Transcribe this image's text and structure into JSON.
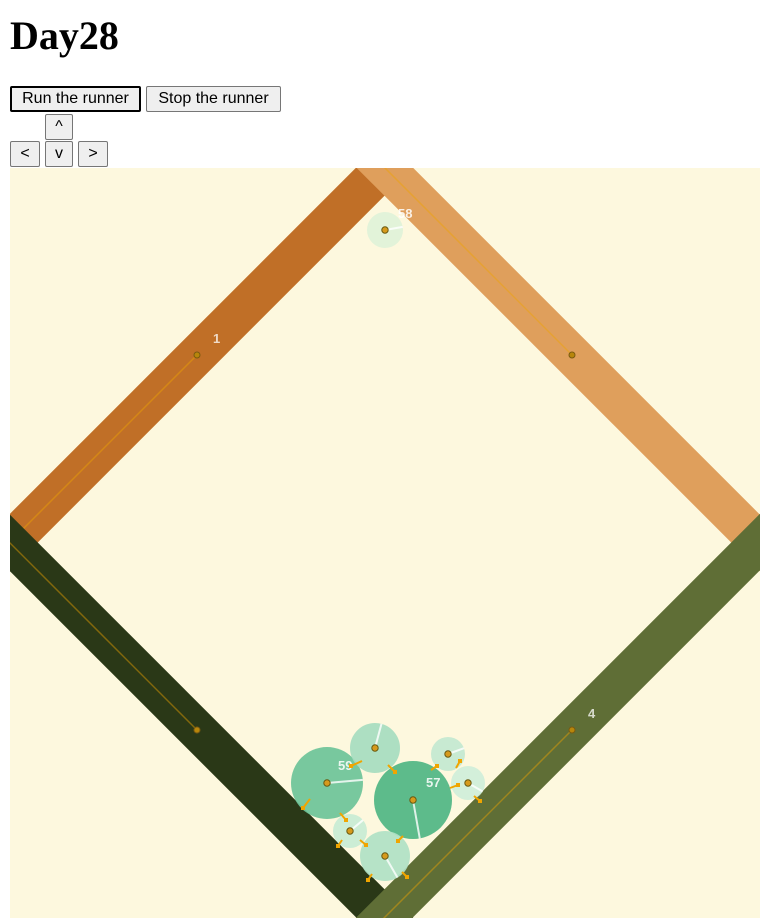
{
  "page": {
    "title": "Day28"
  },
  "controls": {
    "run_label": "Run the runner",
    "stop_label": "Stop the runner",
    "up_label": "^",
    "left_label": "<",
    "down_label": "v",
    "right_label": ">"
  },
  "scene": {
    "background_color": "#fdf8de",
    "walls": [
      {
        "name": "wall-1",
        "label": "1",
        "color": "#c06f27"
      },
      {
        "name": "wall-2",
        "label": "",
        "color": "#df9f5c"
      },
      {
        "name": "wall-3",
        "label": "",
        "color": "#2a3817"
      },
      {
        "name": "wall-4",
        "label": "4",
        "color": "#5f6e36"
      }
    ],
    "bodies": [
      {
        "label": "58",
        "color": "#dff2d8"
      },
      {
        "label": "59",
        "color": "#6dc398"
      },
      {
        "label": "",
        "color": "#a6dcbf"
      },
      {
        "label": "57",
        "color": "#4fb583"
      },
      {
        "label": "",
        "color": "#c3e8d0"
      },
      {
        "label": "",
        "color": "#cfeed9"
      },
      {
        "label": "",
        "color": "#c8ebd4"
      },
      {
        "label": "",
        "color": "#b0e1c4"
      }
    ],
    "accent_color": "#f0a500"
  }
}
